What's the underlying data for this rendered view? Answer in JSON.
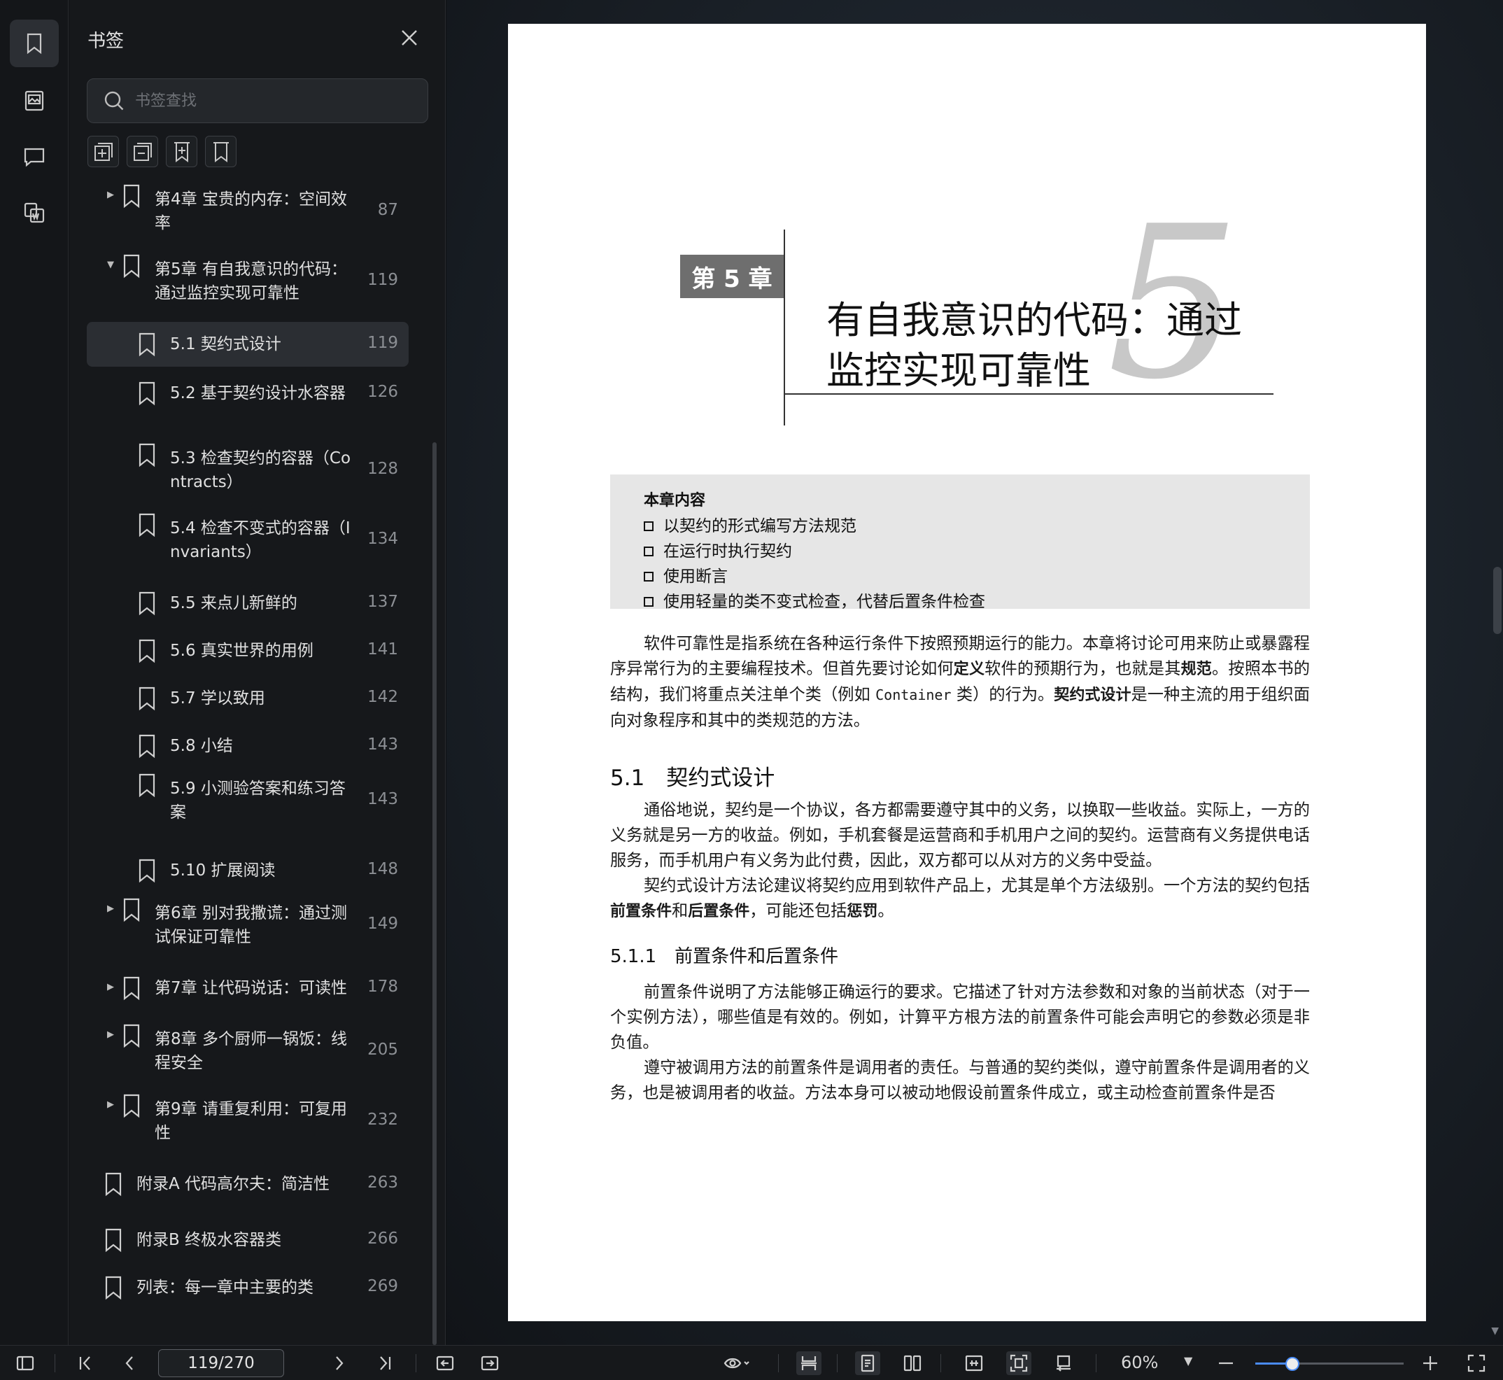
{
  "sidebar": {
    "title": "书签",
    "search_placeholder": "书签查找",
    "bookmarks": [
      {
        "label": "第4章 宝贵的内存：空间效\n率",
        "page": "87",
        "level": 0,
        "arrow": "right"
      },
      {
        "label": "第5章 有自我意识的代码：\n通过监控实现可靠性",
        "page": "119",
        "level": 0,
        "arrow": "down"
      },
      {
        "label": "5.1 契约式设计",
        "page": "119",
        "level": 1,
        "active": true
      },
      {
        "label": "5.2 基于契约设计水容器",
        "page": "126",
        "level": 1
      },
      {
        "label": "5.3 检查契约的容器（Co\nntracts）",
        "page": "128",
        "level": 1
      },
      {
        "label": "5.4 检查不变式的容器（I\nnvariants）",
        "page": "134",
        "level": 1
      },
      {
        "label": "5.5 来点儿新鲜的",
        "page": "137",
        "level": 1
      },
      {
        "label": "5.6 真实世界的用例",
        "page": "141",
        "level": 1
      },
      {
        "label": "5.7 学以致用",
        "page": "142",
        "level": 1
      },
      {
        "label": "5.8 小结",
        "page": "143",
        "level": 1
      },
      {
        "label": "5.9 小测验答案和练习答\n案",
        "page": "143",
        "level": 1
      },
      {
        "label": "5.10 扩展阅读",
        "page": "148",
        "level": 1
      },
      {
        "label": "第6章 别对我撒谎：通过测\n试保证可靠性",
        "page": "149",
        "level": 0,
        "arrow": "right"
      },
      {
        "label": "第7章 让代码说话：可读性",
        "page": "178",
        "level": 0,
        "arrow": "right"
      },
      {
        "label": "第8章 多个厨师一锅饭：线\n程安全",
        "page": "205",
        "level": 0,
        "arrow": "right"
      },
      {
        "label": "第9章 请重复利用：可复用\n性",
        "page": "232",
        "level": 0,
        "arrow": "right"
      },
      {
        "label": "附录A 代码高尔夫：简洁性",
        "page": "263",
        "level": -1
      },
      {
        "label": "附录B 终极水容器类",
        "page": "266",
        "level": -1
      },
      {
        "label": "列表：每一章中主要的类",
        "page": "269",
        "level": -1
      }
    ]
  },
  "document": {
    "chapter_badge": "第 5 章",
    "chapter_number": "5",
    "chapter_title": "有自我意识的代码：通过\n监控实现可靠性",
    "contents_box": {
      "title": "本章内容",
      "items": [
        "以契约的形式编写方法规范",
        "在运行时执行契约",
        "使用断言",
        "使用轻量的类不变式检查，代替后置条件检查"
      ]
    },
    "intro": {
      "p1": "软件可靠性是指系统在各种运行条件下按照预期运行的能力。本章将讨论可用来防止或暴露程序异常行为的主要编程技术。但首先要讨论如何",
      "b1": "定义",
      "p2": "软件的预期行为，也就是其",
      "b2": "规范",
      "p3": "。按照本书的结构，我们将重点关注单个类（例如 ",
      "code": "Container",
      "p4": " 类）的行为。",
      "b3": "契约式设计",
      "p5": "是一种主流的用于组织面向对象程序和其中的类规范的方法。"
    },
    "section_5_1": {
      "heading": "5.1　契约式设计",
      "para1": "通俗地说，契约是一个协议，各方都需要遵守其中的义务，以换取一些收益。实际上，一方的义务就是另一方的收益。例如，手机套餐是运营商和手机用户之间的契约。运营商有义务提供电话服务，而手机用户有义务为此付费，因此，双方都可以从对方的义务中受益。",
      "para2_a": "契约式设计方法论建议将契约应用到软件产品上，尤其是单个方法级别。一个方法的契约包括",
      "para2_b1": "前置条件",
      "para2_c": "和",
      "para2_b2": "后置条件",
      "para2_d": "，可能还包括",
      "para2_b3": "惩罚",
      "para2_e": "。"
    },
    "section_5_1_1": {
      "heading": "5.1.1　前置条件和后置条件",
      "para1": "前置条件说明了方法能够正确运行的要求。它描述了针对方法参数和对象的当前状态（对于一个实例方法），哪些值是有效的。例如，计算平方根方法的前置条件可能会声明它的参数必须是非负值。",
      "para2": "遵守被调用方法的前置条件是调用者的责任。与普通的契约类似，遵守前置条件是调用者的义务，也是被调用者的收益。方法本身可以被动地假设前置条件成立，或主动检查前置条件是否"
    }
  },
  "toolbar": {
    "page_indicator": "119/270",
    "zoom_label": "60%",
    "zoom_level": 0.25
  },
  "colors": {
    "accent": "#4a8cf7",
    "panel_bg": "#16181b",
    "page_bg": "#ffffff"
  }
}
